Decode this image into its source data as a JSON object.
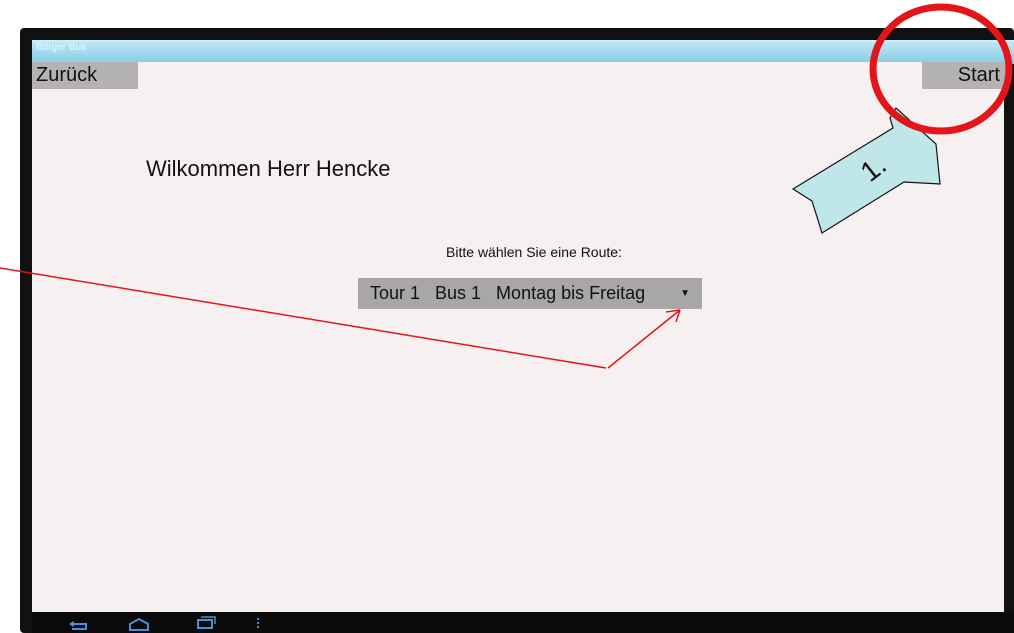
{
  "window": {
    "title": "Bürger Bus"
  },
  "toolbar": {
    "back_label": "Zurück",
    "start_label": "Start"
  },
  "main": {
    "welcome": "Wilkommen Herr Hencke",
    "route_prompt": "Bitte wählen Sie eine Route:",
    "route_selected": "Tour 1   Bus 1   Montag bis Freitag",
    "dropdown_icon": "chevron-down-icon"
  },
  "annotation": {
    "step_label": "1."
  },
  "colors": {
    "screen_bg": "#f7f0f0",
    "button_bg": "#b5b2b2",
    "annotation_red": "#e3141a",
    "arrow_fill": "#bfe6e9"
  },
  "navbar": {
    "icons": [
      "back-icon",
      "home-icon",
      "recent-apps-icon",
      "menu-icon"
    ]
  }
}
